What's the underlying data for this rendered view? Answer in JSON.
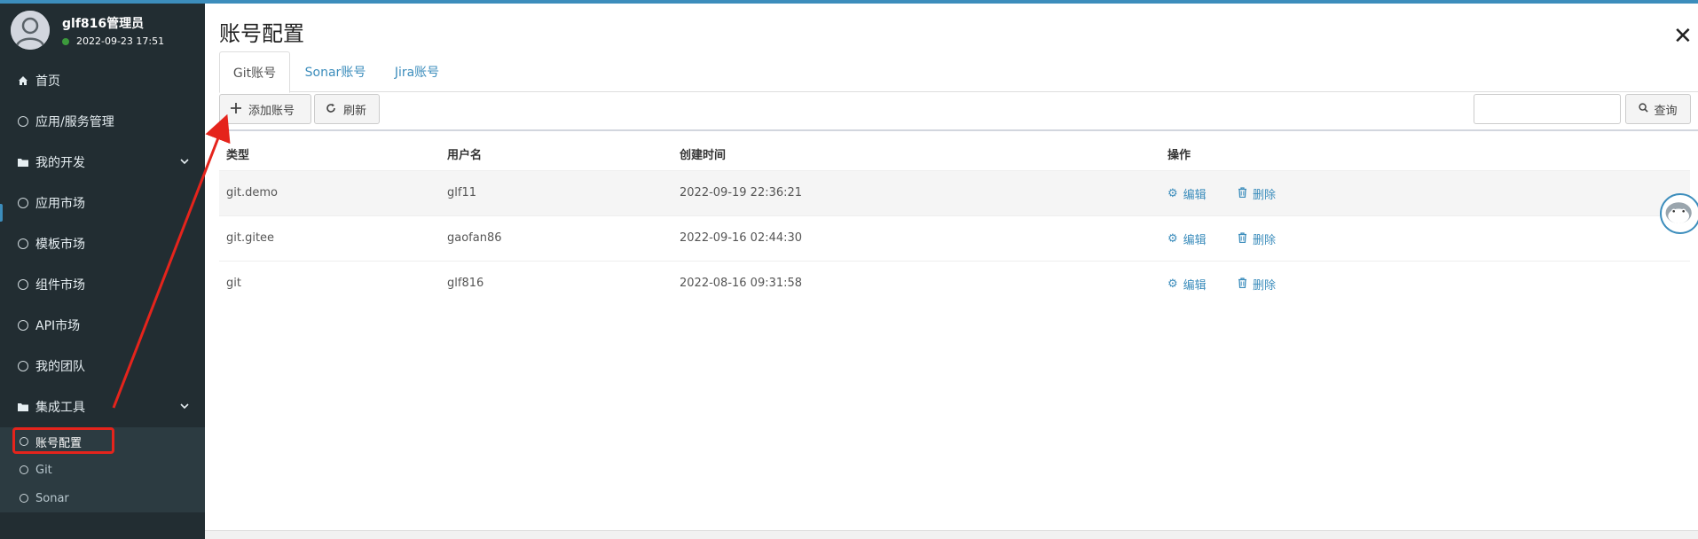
{
  "user": {
    "name": "glf816管理员",
    "timestamp": "2022-09-23 17:51"
  },
  "sidebar": {
    "items": [
      {
        "label": "首页",
        "icon": "home-icon"
      },
      {
        "label": "应用/服务管理",
        "icon": "circle-icon"
      },
      {
        "label": "我的开发",
        "icon": "folder-icon"
      },
      {
        "label": "应用市场",
        "icon": "circle-icon"
      },
      {
        "label": "模板市场",
        "icon": "circle-icon"
      },
      {
        "label": "组件市场",
        "icon": "circle-icon"
      },
      {
        "label": "API市场",
        "icon": "circle-icon"
      },
      {
        "label": "我的团队",
        "icon": "circle-icon"
      },
      {
        "label": "集成工具",
        "icon": "folder-icon"
      }
    ],
    "subitems": [
      {
        "label": "账号配置"
      },
      {
        "label": "Git"
      },
      {
        "label": "Sonar"
      }
    ]
  },
  "page": {
    "title": "账号配置"
  },
  "tabs": [
    {
      "label": "Git账号"
    },
    {
      "label": "Sonar账号"
    },
    {
      "label": "Jira账号"
    }
  ],
  "toolbar": {
    "add_label": "添加账号",
    "refresh_label": "刷新",
    "search_label": "查询",
    "search_value": ""
  },
  "table": {
    "headers": [
      "类型",
      "用户名",
      "创建时间",
      "操作"
    ],
    "rows": [
      {
        "type": "git.demo",
        "user": "glf11",
        "created": "2022-09-19 22:36:21"
      },
      {
        "type": "git.gitee",
        "user": "gaofan86",
        "created": "2022-09-16 02:44:30"
      },
      {
        "type": "git",
        "user": "glf816",
        "created": "2022-08-16 09:31:58"
      }
    ],
    "actions": {
      "edit": "编辑",
      "delete": "删除"
    }
  },
  "colors": {
    "sidebar_bg": "#222d32",
    "accent": "#3c8dbc",
    "annotation": "#e5241c"
  }
}
